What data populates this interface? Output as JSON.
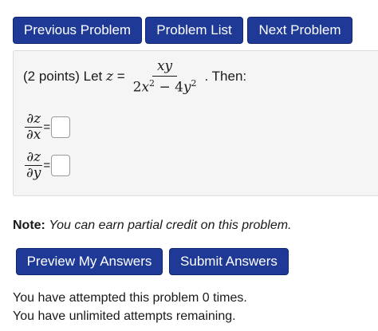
{
  "nav": {
    "previous_label": "Previous Problem",
    "list_label": "Problem List",
    "next_label": "Next Problem"
  },
  "problem": {
    "points": "(2 points)",
    "let_text": "Let",
    "variable": "z",
    "equals": "=",
    "numerator": "xy",
    "denominator_pre": "2",
    "denominator_x": "x",
    "denominator_exp1": "2",
    "denominator_minus": " − 4",
    "denominator_y": "y",
    "denominator_exp2": "2",
    "then_text": ". Then:",
    "derivatives": [
      {
        "top": "∂z",
        "bottom": "∂x",
        "equals": "=",
        "value": ""
      },
      {
        "top": "∂z",
        "bottom": "∂y",
        "equals": "=",
        "value": ""
      }
    ]
  },
  "note": {
    "label": "Note:",
    "text": "You can earn partial credit on this problem."
  },
  "actions": {
    "preview_label": "Preview My Answers",
    "submit_label": "Submit Answers"
  },
  "status": {
    "attempts_line": "You have attempted this problem 0 times.",
    "remaining_line": "You have unlimited attempts remaining."
  },
  "colors": {
    "button_bg": "#1e3a96",
    "panel_bg": "#f5f5f5"
  }
}
